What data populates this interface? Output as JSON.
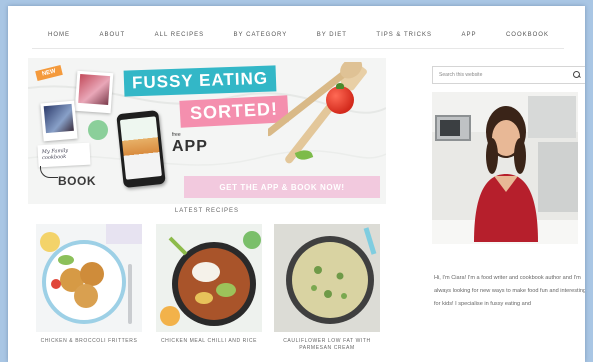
{
  "nav": {
    "items": [
      "HOME",
      "ABOUT",
      "ALL RECIPES",
      "BY CATEGORY",
      "BY DIET",
      "TIPS & TRICKS",
      "APP",
      "COOKBOOK"
    ]
  },
  "hero": {
    "new_tag": "NEW",
    "headline_1": "FUSSY EATING",
    "headline_2": "SORTED!",
    "free_label": "free",
    "app_label": "APP",
    "book_label": "BOOK",
    "note_text": "My Family cookbook",
    "cta_label": "GET THE APP & BOOK NOW!"
  },
  "latest": {
    "title": "LATEST RECIPES",
    "cards": [
      {
        "title": "CHICKEN & BROCCOLI FRITTERS"
      },
      {
        "title": "CHICKEN MEAL CHILLI AND RICE"
      },
      {
        "title": "CAULIFLOWER LOW FAT WITH PARMESAN CREAM"
      }
    ]
  },
  "sidebar": {
    "search_placeholder": "Search this website",
    "bio": "Hi, I'm Ciara! I'm a food writer and cookbook author and I'm always looking for new ways to make food fun and interesting for kids! I specialise in fussy eating and"
  },
  "colors": {
    "teal": "#33b7c7",
    "pink": "#f48fae",
    "cta_pink": "#f2c9de",
    "orange": "#f49a3c"
  }
}
